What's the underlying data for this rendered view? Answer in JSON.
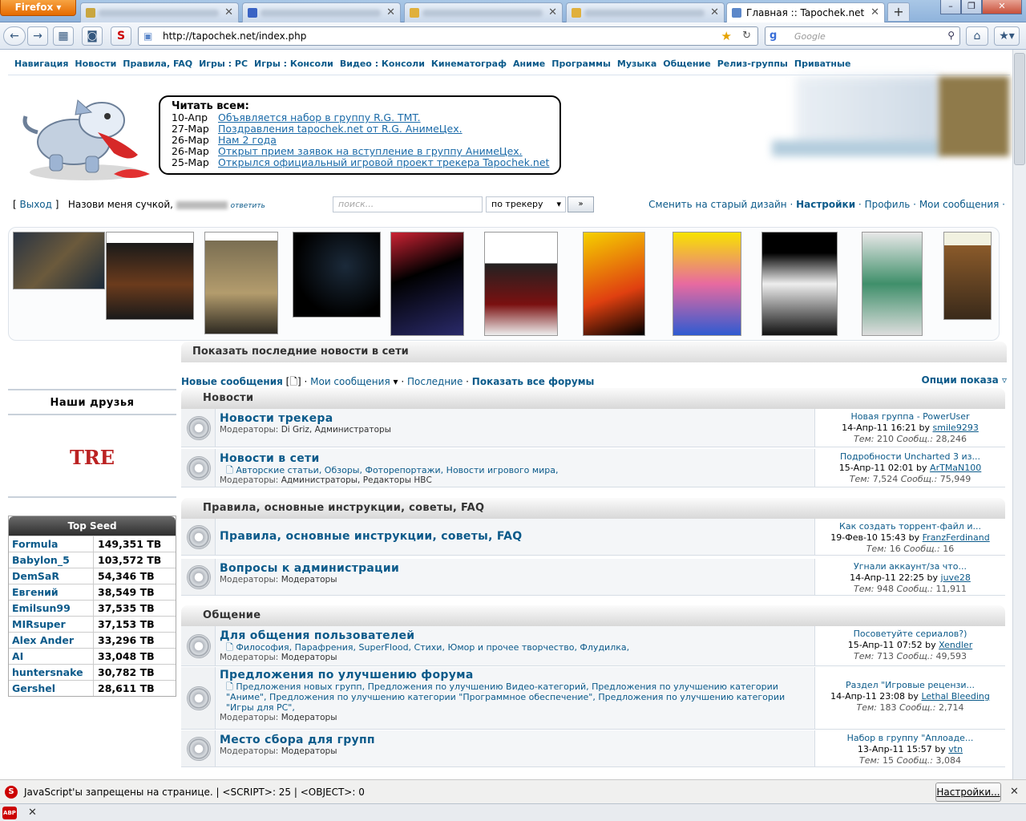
{
  "browser": {
    "app_button": "Firefox",
    "active_tab_title": "Главная :: Tapochek.net",
    "url": "http://tapochek.net/index.php",
    "search_placeholder": "Google"
  },
  "menu": [
    "Навигация",
    "Новости",
    "Правила, FAQ",
    "Игры : PC",
    "Игры : Консоли",
    "Видео : Консоли",
    "Кинематограф",
    "Аниме",
    "Программы",
    "Музыка",
    "Общение",
    "Релиз-группы",
    "Приватные"
  ],
  "announce": {
    "heading": "Читать всем:",
    "items": [
      {
        "date": "10-Апр",
        "text": "Объявляется набор в группу R.G. TMT."
      },
      {
        "date": "27-Мар",
        "text": "Поздравления tapochek.net от R.G. АнимеЦех."
      },
      {
        "date": "26-Мар",
        "text": "Нам 2 года"
      },
      {
        "date": "26-Мар",
        "text": "Открыт прием заявок на вступление в группу АнимеЦех."
      },
      {
        "date": "25-Мар",
        "text": "Открылся официальный игровой проект трекера Tapochek.net"
      }
    ]
  },
  "userbar": {
    "logout": "Выход",
    "greeting": "Назови меня сучкой,",
    "reply": "ответить",
    "search_placeholder": "поиск...",
    "search_scope": "по трекеру",
    "go": "»",
    "links": [
      "Сменить на старый дизайн",
      "Настройки",
      "Профиль",
      "Мои сообщения"
    ]
  },
  "news_bar": "Показать последние новости в сети",
  "subnav": {
    "new_posts": "Новые сообщения",
    "my_posts": "Мои сообщения",
    "latest": "Последние",
    "all_forums": "Показать все форумы",
    "options": "Опции показа"
  },
  "friends_title": "Наши друзья",
  "friends_logo": "TRE",
  "top_seed": {
    "title": "Top Seed",
    "rows": [
      {
        "name": "Formula",
        "value": "149,351 TB"
      },
      {
        "name": "Babylon_5",
        "value": "103,572 TB"
      },
      {
        "name": "DemSaR",
        "value": "54,346 TB"
      },
      {
        "name": "Евгений",
        "value": "38,549 TB"
      },
      {
        "name": "Emilsun99",
        "value": "37,535 TB"
      },
      {
        "name": "MIRsuper",
        "value": "37,153 TB"
      },
      {
        "name": "Alex Ander",
        "value": "33,296 TB"
      },
      {
        "name": "AI",
        "value": "33,048 TB"
      },
      {
        "name": "huntersnake",
        "value": "30,782 TB"
      },
      {
        "name": "Gershel",
        "value": "28,611 TB"
      }
    ]
  },
  "categories": [
    {
      "title": "Новости"
    },
    {
      "title": "Правила, основные инструкции, советы, FAQ"
    },
    {
      "title": "Общение"
    }
  ],
  "forums": [
    {
      "title": "Новости трекера",
      "subs": "",
      "mods": "Di Griz, Администраторы",
      "last_title": "Новая группа - PowerUser",
      "last_date": "14-Апр-11 16:21",
      "last_user": "smile9293",
      "topics": "210",
      "posts": "28,246"
    },
    {
      "title": "Новости в сети",
      "subs": "Авторские статьи, Обзоры, Фоторепортажи, Новости игрового мира,",
      "mods": "Администраторы, Редакторы НВС",
      "last_title": "Подробности Uncharted 3 из...",
      "last_date": "15-Апр-11 02:01",
      "last_user": "ArTMaN100",
      "topics": "7,524",
      "posts": "75,949"
    },
    {
      "title": "Правила, основные инструкции, советы, FAQ",
      "subs": "",
      "mods": "",
      "last_title": "Как создать торрент-файл и...",
      "last_date": "19-Фев-10 15:43",
      "last_user": "FranzFerdinand",
      "topics": "16",
      "posts": "16"
    },
    {
      "title": "Вопросы к администрации",
      "subs": "",
      "mods": "Модераторы",
      "last_title": "Угнали аккаунт/за что...",
      "last_date": "14-Апр-11 22:25",
      "last_user": "juve28",
      "topics": "948",
      "posts": "11,911"
    },
    {
      "title": "Для общения пользователей",
      "subs": "Философия, Парафрения, SuperFlood, Стихи, Юмор и прочее творчество, Флудилка,",
      "mods": "Модераторы",
      "last_title": "Посоветуйте сериалов?)",
      "last_date": "15-Апр-11 07:52",
      "last_user": "Xendler",
      "topics": "713",
      "posts": "49,593"
    },
    {
      "title": "Предложения по улучшению форума",
      "subs": "Предложения новых групп, Предложения по улучшению Видео-категорий, Предложения по улучшению категории \"Аниме\", Предложения по улучшению категории \"Программное обеспечение\", Предложения по улучшению категории \"Игры для PC\",",
      "mods": "Модераторы",
      "last_title": "Раздел \"Игровые рецензи...",
      "last_date": "14-Апр-11 23:08",
      "last_user": "Lethal Bleeding",
      "topics": "183",
      "posts": "2,714"
    },
    {
      "title": "Место сбора для групп",
      "subs": "",
      "mods": "Модераторы",
      "last_title": "Набор в группу \"Аплоаде...",
      "last_date": "13-Апр-11 15:57",
      "last_user": "vtn",
      "topics": "15",
      "posts": "3,084"
    }
  ],
  "labels": {
    "moderators": "Модераторы:",
    "by": "by",
    "topics": "Тем:",
    "posts": "Сообщ.:"
  },
  "jsbar": {
    "text": "JavaScript'ы запрещены на странице. | <SCRIPT>: 25 | <OBJECT>: 0",
    "button": "Настройки..."
  }
}
